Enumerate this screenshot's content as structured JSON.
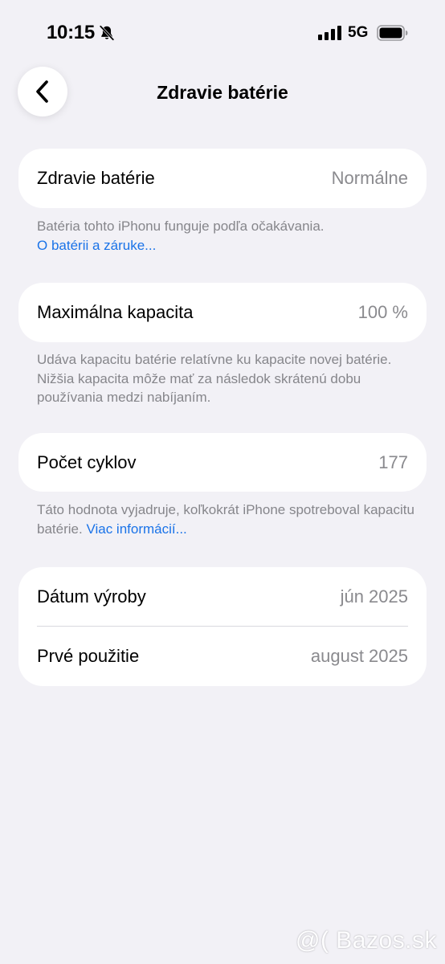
{
  "status_bar": {
    "time": "10:15",
    "network": "5G",
    "icons": [
      "bell-slash-icon",
      "signal-bars-icon",
      "battery-icon"
    ]
  },
  "nav": {
    "title": "Zdravie batérie",
    "back_icon": "chevron-left-icon"
  },
  "sections": {
    "health": {
      "label": "Zdravie batérie",
      "value": "Normálne",
      "note": "Batéria tohto iPhonu funguje podľa očakávania.",
      "link": "O batérii a záruke..."
    },
    "capacity": {
      "label": "Maximálna kapacita",
      "value": "100 %",
      "note": "Udáva kapacitu batérie relatívne ku kapacite novej batérie. Nižšia kapacita môže mať za následok skrátenú dobu používania medzi nabíjaním."
    },
    "cycles": {
      "label": "Počet cyklov",
      "value": "177",
      "note": "Táto hodnota vyjadruje, koľkokrát iPhone spotreboval kapacitu batérie.",
      "link": "Viac informácií..."
    },
    "dates": {
      "manufacture_label": "Dátum výroby",
      "manufacture_value": "jún 2025",
      "first_use_label": "Prvé použitie",
      "first_use_value": "august 2025"
    }
  },
  "watermark": "@( Bazos.sk",
  "colors": {
    "background": "#f2f1f6",
    "card": "#ffffff",
    "link": "#1a73e8",
    "secondary_text": "#8a8a8e"
  }
}
